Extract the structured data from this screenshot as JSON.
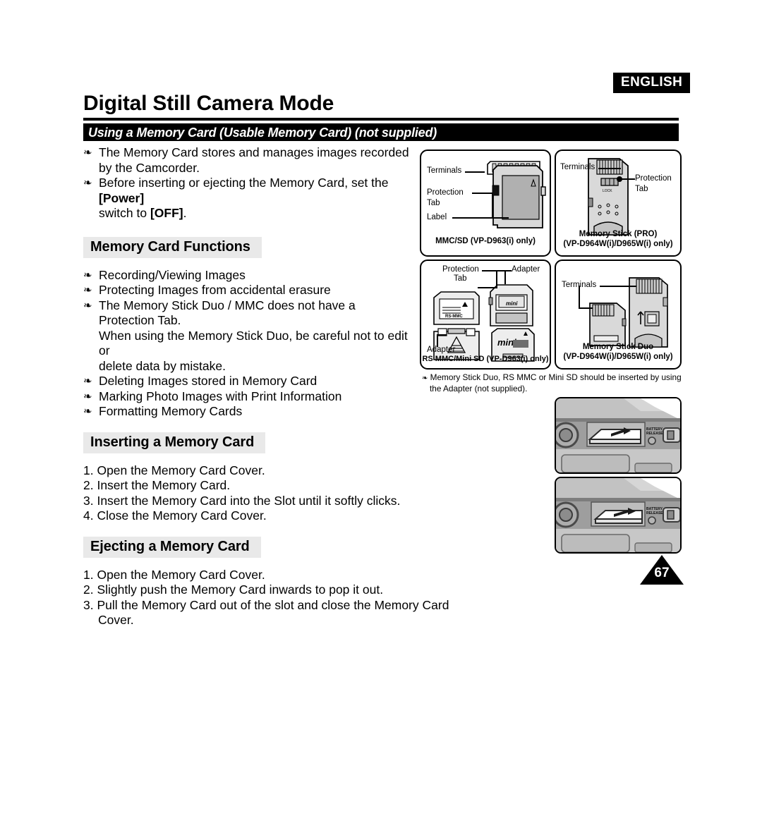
{
  "header": {
    "language_badge": "ENGLISH",
    "page_title": "Digital Still Camera Mode",
    "section_band": "Using a Memory Card (Usable Memory Card) (not supplied)"
  },
  "intro": {
    "bullet1_line1": "The Memory Card stores and manages images recorded",
    "bullet1_line2": "by the Camcorder.",
    "bullet2_line1_a": "Before inserting or ejecting the Memory Card, set the ",
    "bullet2_line1_b": "[Power]",
    "bullet2_line2_a": "switch to ",
    "bullet2_line2_b": "[OFF]",
    "bullet2_line2_c": "."
  },
  "functions": {
    "heading": "Memory Card Functions",
    "items": [
      "Recording/Viewing Images",
      "Protecting Images from accidental erasure",
      "The Memory Stick Duo / MMC does not have a Protection Tab.",
      "Deleting Images stored in Memory Card",
      "Marking Photo Images with Print Information",
      "Formatting Memory Cards"
    ],
    "item3_cont1": "When using the Memory Stick Duo, be careful not to edit or",
    "item3_cont2": "delete data by mistake."
  },
  "inserting": {
    "heading": "Inserting a Memory Card",
    "steps": [
      "1. Open the Memory Card Cover.",
      "2. Insert the Memory Card.",
      "3. Insert the Memory Card into the Slot until it softly clicks.",
      "4. Close the Memory Card Cover."
    ]
  },
  "ejecting": {
    "heading": "Ejecting a Memory Card",
    "steps": [
      "1. Open the Memory Card Cover.",
      "2. Slightly push the Memory Card inwards to pop it out.",
      "3. Pull the Memory Card out of the slot and close the Memory Card Cover."
    ]
  },
  "diagrams": {
    "mmc_sd": {
      "caption": "MMC/SD (VP-D963(i) only)",
      "label_terminals": "Terminals",
      "label_protection": "Protection",
      "label_tab": "Tab",
      "label_label": "Label"
    },
    "memory_stick_pro": {
      "caption_line1": "Memory Stick (PRO)",
      "caption_line2": "(VP-D964W(i)/D965W(i) only)",
      "label_terminals": "Terminals",
      "label_protection": "Protection",
      "label_tab": "Tab",
      "lock_mark": "LOCK"
    },
    "rs_mmc_mini_sd": {
      "caption": "RS MMC/Mini SD (VP-D963(i) only)",
      "label_protection": "Protection",
      "label_tab": "Tab",
      "label_adapter_top": "Adapter",
      "label_adapter_bottom": "Adapter",
      "card_mark_rsmmc": "RS-MMC",
      "card_mark_mini": "mini",
      "card_mark_minisd": "mini"
    },
    "memory_stick_duo": {
      "caption_line1": "Memory Stick Duo",
      "caption_line2": "(VP-D964W(i)/D965W(i) only)",
      "label_terminals": "Terminals"
    }
  },
  "note": {
    "line1": "Memory Stick Duo, RS MMC or Mini SD should be inserted by using",
    "line2": "the Adapter (not supplied)."
  },
  "photos": {
    "photo_top_alt": "camcorder memory card slot with card being inserted",
    "photo_bottom_alt": "camcorder memory card slot with card pushed in",
    "battery_release_label": "BATTERY RELEASE"
  },
  "footer": {
    "page_number": "67"
  },
  "colors": {
    "ink": "#000000",
    "band": "#000000",
    "subhead_bg": "#e9e9e9",
    "card_gray": "#b0b0b0",
    "photo_gray": "#b8b8b8"
  }
}
